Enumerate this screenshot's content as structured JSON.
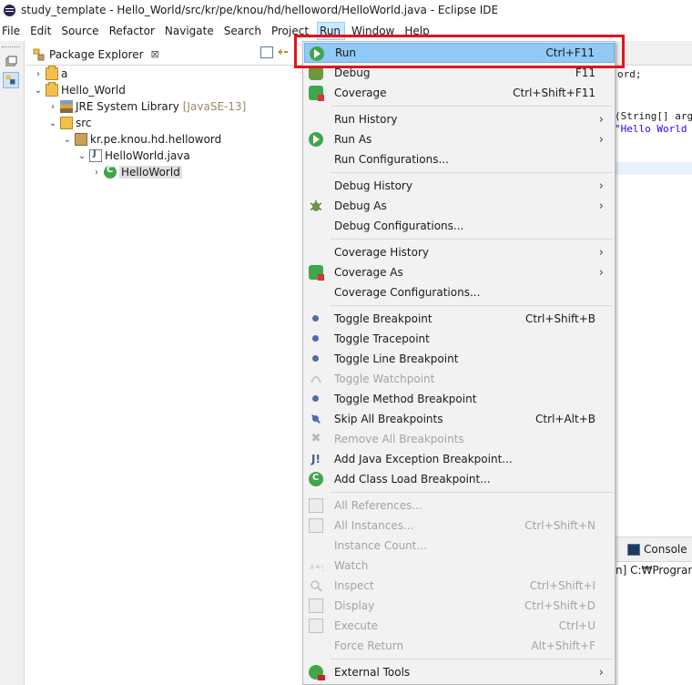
{
  "window": {
    "title": "study_template - Hello_World/src/kr/pe/knou/hd/helloword/HelloWorld.java - Eclipse IDE"
  },
  "menubar": [
    "File",
    "Edit",
    "Source",
    "Refactor",
    "Navigate",
    "Search",
    "Project",
    "Run",
    "Window",
    "Help"
  ],
  "package_explorer": {
    "tab_label": "Package Explorer",
    "close_glyph": "⊠",
    "tree": [
      {
        "label": "a"
      },
      {
        "label": "Hello_World"
      },
      {
        "label": "JRE System Library",
        "suffix": "[JavaSE-13]"
      },
      {
        "label": "src"
      },
      {
        "label": "kr.pe.knou.hd.helloword"
      },
      {
        "label": "HelloWorld.java"
      },
      {
        "label": "HelloWorld"
      }
    ]
  },
  "editor": {
    "code_line1": "ord;",
    "code_line2": "(String[] arg",
    "code_line3": "\"Hello World"
  },
  "console": {
    "tab_label": "Console",
    "path_text": "n] C:₩Program F"
  },
  "run_menu": {
    "items": [
      {
        "label": "Run",
        "accel": "Ctrl+F11"
      },
      {
        "label": "Debug",
        "accel": "F11"
      },
      {
        "label": "Coverage",
        "accel": "Ctrl+Shift+F11"
      },
      {
        "label": "Run History"
      },
      {
        "label": "Run As"
      },
      {
        "label": "Run Configurations..."
      },
      {
        "label": "Debug History"
      },
      {
        "label": "Debug As"
      },
      {
        "label": "Debug Configurations..."
      },
      {
        "label": "Coverage History"
      },
      {
        "label": "Coverage As"
      },
      {
        "label": "Coverage Configurations..."
      },
      {
        "label": "Toggle Breakpoint",
        "accel": "Ctrl+Shift+B"
      },
      {
        "label": "Toggle Tracepoint"
      },
      {
        "label": "Toggle Line Breakpoint"
      },
      {
        "label": "Toggle Watchpoint"
      },
      {
        "label": "Toggle Method Breakpoint"
      },
      {
        "label": "Skip All Breakpoints",
        "accel": "Ctrl+Alt+B"
      },
      {
        "label": "Remove All Breakpoints"
      },
      {
        "label": "Add Java Exception Breakpoint..."
      },
      {
        "label": "Add Class Load Breakpoint..."
      },
      {
        "label": "All References..."
      },
      {
        "label": "All Instances...",
        "accel": "Ctrl+Shift+N"
      },
      {
        "label": "Instance Count..."
      },
      {
        "label": "Watch"
      },
      {
        "label": "Inspect",
        "accel": "Ctrl+Shift+I"
      },
      {
        "label": "Display",
        "accel": "Ctrl+Shift+D"
      },
      {
        "label": "Execute",
        "accel": "Ctrl+U"
      },
      {
        "label": "Force Return",
        "accel": "Alt+Shift+F"
      },
      {
        "label": "External Tools"
      }
    ],
    "submenu_arrow": "›"
  },
  "colors": {
    "highlight": "#91c9f7",
    "annotation_box": "#e8121b",
    "string_literal": "#2a00ff"
  }
}
